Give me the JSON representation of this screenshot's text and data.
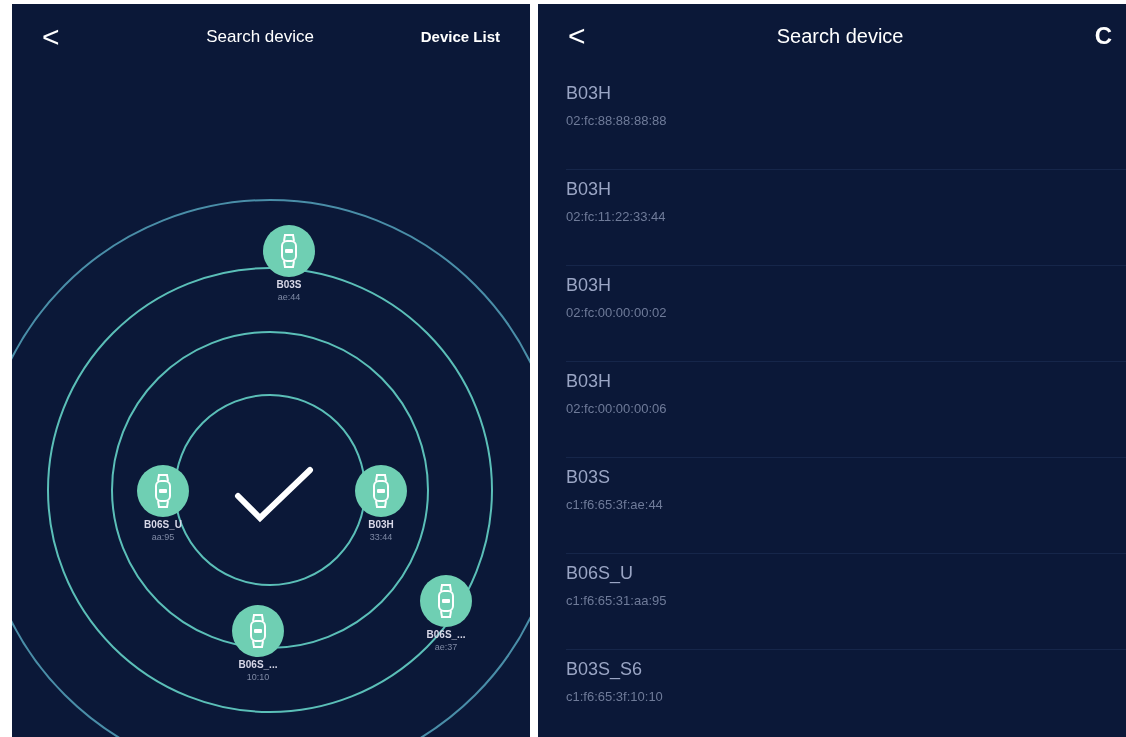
{
  "radar_screen": {
    "back": "<",
    "title": "Search device",
    "action": "Device List",
    "scan_done": true,
    "devices": [
      {
        "name": "B03S",
        "address": "ae:44"
      },
      {
        "name": "B06S_U",
        "address": "aa:95"
      },
      {
        "name": "B03H",
        "address": "33:44"
      },
      {
        "name": "B06S_...",
        "address": "10:10"
      },
      {
        "name": "B06S_...",
        "address": "ae:37"
      }
    ]
  },
  "list_screen": {
    "back": "<",
    "title": "Search device",
    "refresh": "C",
    "devices": [
      {
        "name": "B03H",
        "address": "02:fc:88:88:88:88"
      },
      {
        "name": "B03H",
        "address": "02:fc:11:22:33:44"
      },
      {
        "name": "B03H",
        "address": "02:fc:00:00:00:02"
      },
      {
        "name": "B03H",
        "address": "02:fc:00:00:00:06"
      },
      {
        "name": "B03S",
        "address": "c1:f6:65:3f:ae:44"
      },
      {
        "name": "B06S_U",
        "address": "c1:f6:65:31:aa:95"
      },
      {
        "name": "B03S_S6",
        "address": "c1:f6:65:3f:10:10"
      }
    ]
  }
}
